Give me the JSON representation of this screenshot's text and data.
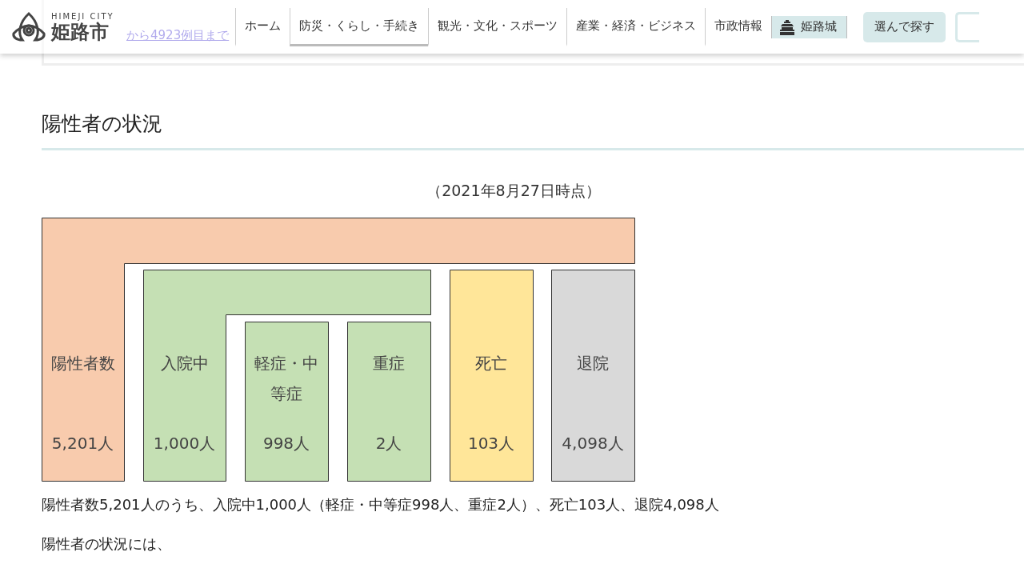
{
  "header": {
    "logo_sub": "HIMEJI CITY",
    "logo_main": "姫路市",
    "nav": [
      {
        "label": "ホーム",
        "selected": false
      },
      {
        "label": "防災・くらし・手続き",
        "selected": true
      },
      {
        "label": "観光・文化・スポーツ",
        "selected": false
      },
      {
        "label": "産業・経済・ビジネス",
        "selected": false
      },
      {
        "label": "市政情報",
        "selected": false
      }
    ],
    "castle_link": "姫路城",
    "search_button": "選んで探す"
  },
  "behind_link": "から4923例目まで",
  "section": {
    "title": "陽性者の状況",
    "as_of": "（2021年8月27日時点）",
    "boxes": [
      {
        "label": "陽性者数",
        "count": "5,201人",
        "color": "#f8cbad"
      },
      {
        "label": "入院中",
        "count": "1,000人",
        "color": "#c5e0b4"
      },
      {
        "label": "軽症・中等症",
        "count": "998人",
        "color": "#c5e0b4"
      },
      {
        "label": "重症",
        "count": "2人",
        "color": "#c5e0b4"
      },
      {
        "label": "死亡",
        "count": "103人",
        "color": "#ffe699"
      },
      {
        "label": "退院",
        "count": "4,098人",
        "color": "#d9d9d9"
      }
    ],
    "summary": "陽性者数5,201人のうち、入院中1,000人（軽症・中等症998人、重症2人）、死亡103人、退院4,098人",
    "note": "陽性者の状況には、"
  }
}
